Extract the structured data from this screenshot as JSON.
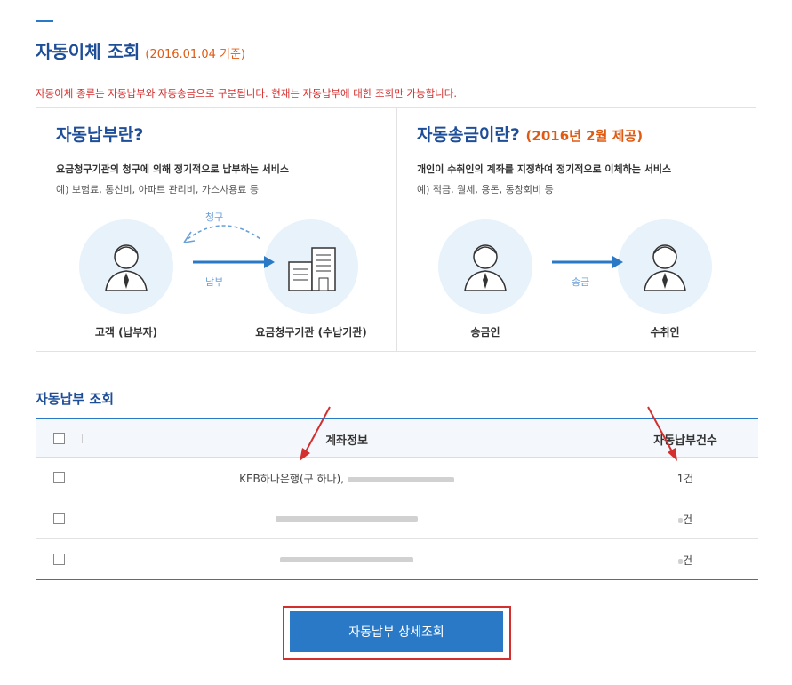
{
  "header": {
    "title": "자동이체 조회",
    "date_note": "(2016.01.04 기준)"
  },
  "notice": "자동이체 종류는 자동납부와 자동송금으로 구분됩니다. 현재는 자동납부에 대한 조회만 가능합니다.",
  "info": {
    "auto_pay": {
      "title": "자동납부란?",
      "desc": "요금청구기관의 청구에 의해 정기적으로 납부하는 서비스",
      "example": "예) 보험료, 통신비, 아파트 관리비, 가스사용료 등",
      "claim_label": "청구",
      "pay_label": "납부",
      "customer_label": "고객 (납부자)",
      "institution_label": "요금청구기관 (수납기관)"
    },
    "auto_transfer": {
      "title": "자동송금이란?",
      "title_sub": "(2016년 2월 제공)",
      "desc": "개인이 수취인의 계좌를 지정하여 정기적으로 이체하는 서비스",
      "example": "예) 적금, 월세, 용돈, 동창회비 등",
      "transfer_label": "송금",
      "sender_label": "송금인",
      "receiver_label": "수취인"
    }
  },
  "inquiry": {
    "section_title": "자동납부 조회",
    "columns": {
      "account": "계좌정보",
      "count": "자동납부건수"
    },
    "rows": [
      {
        "account": "KEB하나은행(구 하나),",
        "count": "1건"
      },
      {
        "account": "",
        "count": "건"
      },
      {
        "account": "",
        "count": "건"
      }
    ]
  },
  "detail_button": "자동납부 상세조회",
  "colors": {
    "primary": "#2a79c6",
    "title": "#1f4e99",
    "accent_orange": "#e05a12",
    "alert_red": "#d32f2f",
    "circle_bg": "#e7f2fb"
  }
}
